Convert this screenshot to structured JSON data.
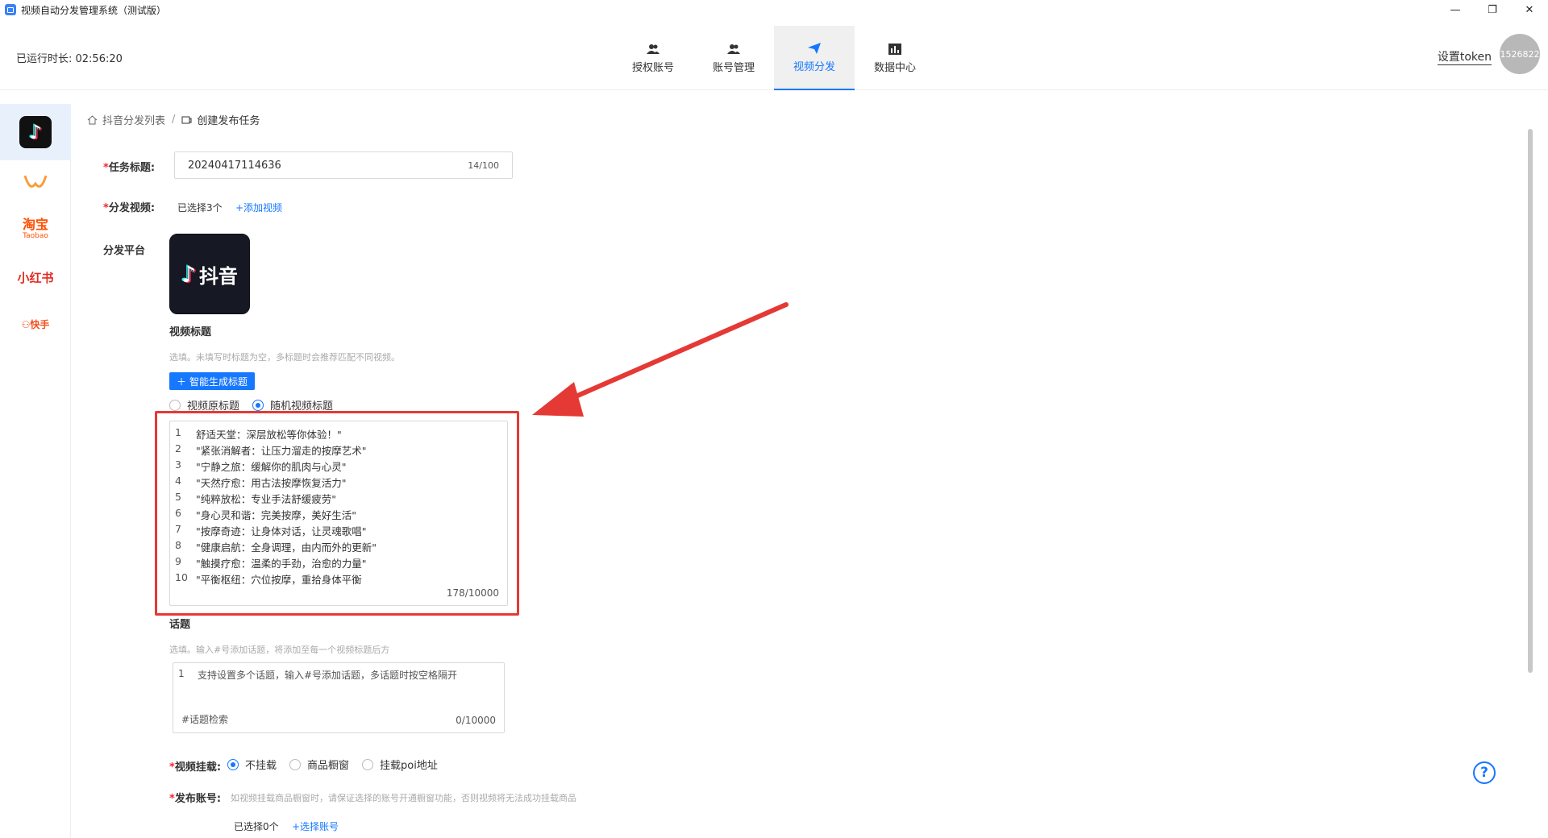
{
  "window": {
    "title": "视频自动分发管理系统（测试版）",
    "controls": [
      "—",
      "❐",
      "✕"
    ]
  },
  "header": {
    "uptime": "已运行时长: 02:56:20",
    "tabs": [
      {
        "label": "授权账号",
        "icon": "users-icon"
      },
      {
        "label": "账号管理",
        "icon": "user-manage-icon"
      },
      {
        "label": "视频分发",
        "icon": "send-icon",
        "active": true
      },
      {
        "label": "数据中心",
        "icon": "chart-icon"
      }
    ],
    "token_label": "设置token",
    "avatar_text": "1526822"
  },
  "sidebar": {
    "items": [
      {
        "name": "抖音",
        "active": true
      },
      {
        "name": "视频号"
      },
      {
        "name": "淘宝",
        "sub": "Taobao"
      },
      {
        "name": "小红书"
      },
      {
        "name": "快手"
      }
    ]
  },
  "breadcrumb": {
    "home": "抖音分发列表",
    "sep": "/",
    "current": "创建发布任务"
  },
  "form": {
    "task_title_label": "任务标题:",
    "task_title_value": "20240417114636",
    "task_title_count": "14/100",
    "video_label": "分发视频:",
    "video_selected": "已选择3个",
    "video_add": "+添加视频",
    "platform_label": "分发平台",
    "platform_logo_text": "抖音",
    "video_title_section": "视频标题",
    "video_title_hint": "选填。未填写时标题为空，多标题时会推荐匹配不同视频。",
    "gen_button": "智能生成标题",
    "radio_original": "视频原标题",
    "radio_random": "随机视频标题",
    "titles": [
      "舒适天堂：深层放松等你体验！\"",
      "\"紧张消解者：让压力溜走的按摩艺术\"",
      "\"宁静之旅：缓解你的肌肉与心灵\"",
      "\"天然疗愈：用古法按摩恢复活力\"",
      "\"纯粹放松：专业手法舒缓疲劳\"",
      "\"身心灵和谐：完美按摩，美好生活\"",
      "\"按摩奇迹：让身体对话，让灵魂歌唱\"",
      "\"健康启航：全身调理，由内而外的更新\"",
      "\"触摸疗愈：温柔的手劲，治愈的力量\"",
      "\"平衡枢纽：穴位按摩，重拾身体平衡"
    ],
    "titles_count": "178/10000",
    "topic_section": "话题",
    "topic_hint": "选填。输入#号添加话题，将添加至每一个视频标题后方",
    "topic_placeholder": "支持设置多个话题，输入#号添加话题，多话题时按空格隔开",
    "topic_search": "#话题检索",
    "topic_count": "0/10000",
    "mount_label": "视频挂载:",
    "mount_opts": [
      "不挂载",
      "商品橱窗",
      "挂载poi地址"
    ],
    "account_label": "发布账号:",
    "account_hint": "如视频挂载商品橱窗时，请保证选择的账号开通橱窗功能，否则视频将无法成功挂载商品",
    "account_selected": "已选择0个",
    "account_select": "+选择账号"
  },
  "help": "?"
}
